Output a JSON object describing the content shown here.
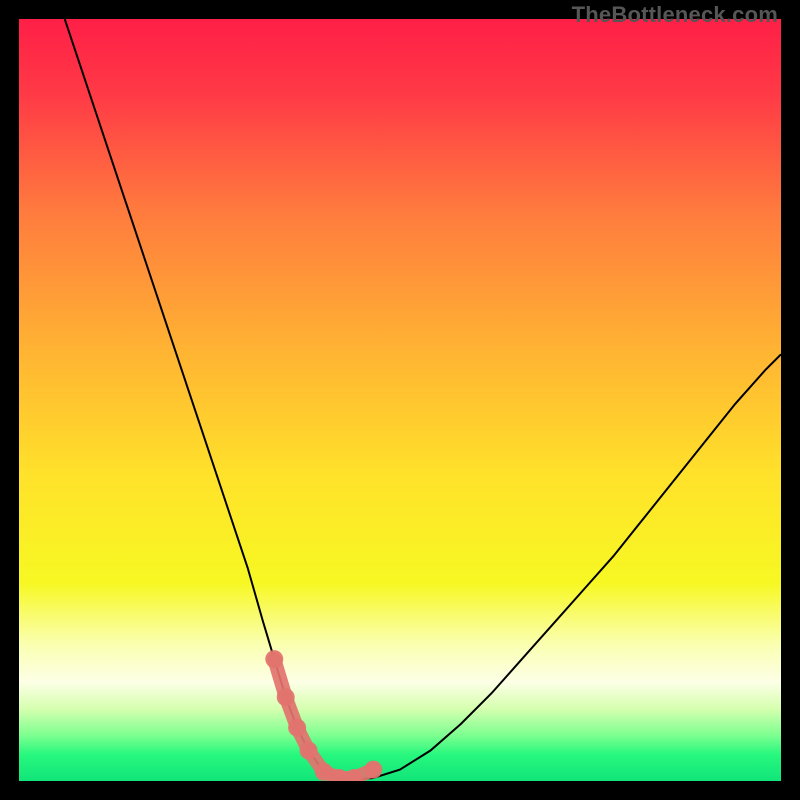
{
  "watermark": "TheBottleneck.com",
  "colors": {
    "frame": "#000000",
    "gradient_stops": [
      {
        "offset": 0.0,
        "color": "#ff1f47"
      },
      {
        "offset": 0.1,
        "color": "#ff3a46"
      },
      {
        "offset": 0.25,
        "color": "#ff7a3e"
      },
      {
        "offset": 0.43,
        "color": "#ffb233"
      },
      {
        "offset": 0.6,
        "color": "#ffe22a"
      },
      {
        "offset": 0.74,
        "color": "#f7f823"
      },
      {
        "offset": 0.82,
        "color": "#faffb0"
      },
      {
        "offset": 0.87,
        "color": "#fdffe6"
      },
      {
        "offset": 0.905,
        "color": "#d6ffb0"
      },
      {
        "offset": 0.94,
        "color": "#7dff90"
      },
      {
        "offset": 0.965,
        "color": "#28f87e"
      },
      {
        "offset": 1.0,
        "color": "#11e57a"
      }
    ],
    "curve": "#000000",
    "overlay": "#e2736e"
  },
  "chart_data": {
    "type": "line",
    "title": "",
    "xlabel": "",
    "ylabel": "",
    "xlim": [
      0,
      100
    ],
    "ylim": [
      0,
      100
    ],
    "grid": false,
    "series": [
      {
        "name": "bottleneck-curve",
        "x": [
          6,
          8,
          10,
          12,
          14,
          16,
          18,
          20,
          22,
          24,
          26,
          28,
          30,
          32,
          33.5,
          35,
          36.5,
          38,
          40,
          42,
          44,
          46.5,
          50,
          54,
          58,
          62,
          66,
          70,
          74,
          78,
          82,
          86,
          90,
          94,
          98,
          100
        ],
        "y": [
          100,
          94,
          88,
          82,
          76,
          70,
          64,
          58,
          52,
          46,
          40,
          34,
          28,
          21,
          16,
          11,
          7,
          4,
          1.2,
          0.4,
          0.2,
          0.4,
          1.5,
          4,
          7.5,
          11.5,
          16,
          20.5,
          25,
          29.5,
          34.5,
          39.5,
          44.5,
          49.5,
          54,
          56
        ]
      }
    ],
    "overlay_segment": {
      "name": "valley-highlight",
      "x": [
        33.5,
        35,
        36.5,
        38,
        40,
        42,
        44,
        46.5
      ],
      "y": [
        16,
        11,
        7,
        4,
        1.2,
        0.4,
        0.4,
        1.5
      ]
    }
  }
}
